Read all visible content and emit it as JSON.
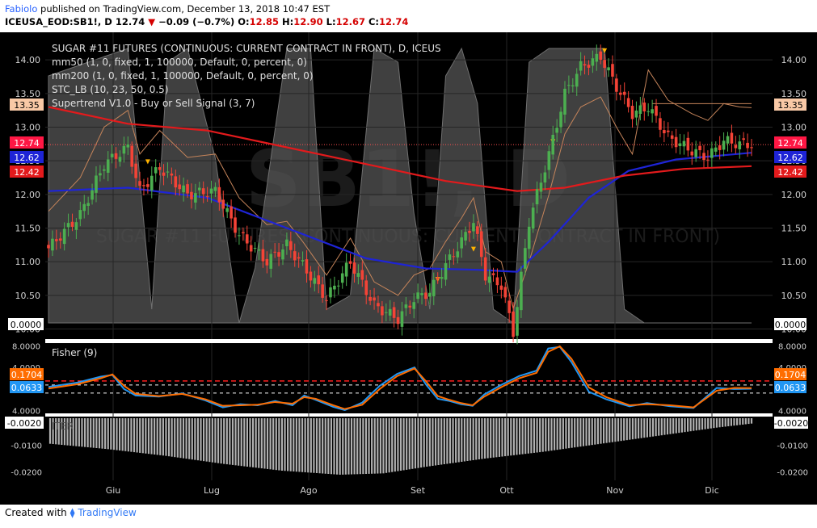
{
  "header": {
    "author": "Fabiolo",
    "published": "published on TradingView.com, December 13, 2018 10:47 EST",
    "symbol": "ICEUSA_EOD:SB1!, D",
    "last": "12.74",
    "change": "−0.09 (−0.7%)",
    "o_label": "O:",
    "o": "12.85",
    "h_label": "H:",
    "h": "12.90",
    "l_label": "L:",
    "l": "12.67",
    "c_label": "C:",
    "c": "12.74"
  },
  "watermark": "SB1!, D",
  "watermark_sub": "SUGAR #11 FUTURES (CONTINUOUS: CURRENT CONTRACT IN FRONT)",
  "legend": [
    "SUGAR #11 FUTURES (CONTINUOUS: CURRENT CONTRACT IN FRONT), D, ICEUS",
    "mm50 (1, 0, fixed, 1, 100000, Default, 0, percent, 0)",
    "mm200 (1, 0, fixed, 1, 100000, Default, 0, percent, 0)",
    "STC_LB (10, 23, 50, 0.5)",
    "Supertrend V1.0 - Buy or Sell Signal (3, 7)"
  ],
  "panes": {
    "fisher_label": "Fisher (9)",
    "iter_label": "ITER"
  },
  "price_badges": {
    "supertrend": "13.35",
    "last": "12.74",
    "mm50": "12.62",
    "mm200": "12.42",
    "stc": "0.0000",
    "fisher_signal": "0.1704",
    "fisher": "0.0633",
    "iter": "-0.0020"
  },
  "colors": {
    "up": "#4caf50",
    "down": "#f44336",
    "mm50": "#1e24d6",
    "mm200": "#e31a1c",
    "supertrend_line": "#c5845a",
    "supertrend_up": "#4caf50",
    "stc_fill": "#555555",
    "fisher": "#2196f3",
    "fisher_signal": "#ff6d00",
    "fisher_level": "#ff1f1f",
    "iter_bar": "#b0b0b0"
  },
  "chart_data": [
    {
      "type": "candlestick",
      "title": "SUGAR #11 FUTURES (CONTINUOUS: CURRENT CONTRACT IN FRONT), D, ICEUS",
      "x_ticks": [
        "Giu",
        "Lug",
        "Ago",
        "Set",
        "Ott",
        "Nov",
        "Dic"
      ],
      "y_ticks": [
        10.0,
        10.5,
        11.0,
        11.5,
        12.0,
        12.5,
        13.0,
        13.5,
        14.0
      ],
      "ylim": [
        9.85,
        14.35
      ],
      "n_bars": 140,
      "price_path_anchors": [
        [
          0,
          11.2
        ],
        [
          8,
          11.7
        ],
        [
          14,
          12.45
        ],
        [
          20,
          12.7
        ],
        [
          23,
          12.05
        ],
        [
          28,
          12.4
        ],
        [
          35,
          12.0
        ],
        [
          42,
          12.05
        ],
        [
          48,
          11.4
        ],
        [
          55,
          11.0
        ],
        [
          60,
          11.25
        ],
        [
          64,
          10.95
        ],
        [
          70,
          10.45
        ],
        [
          76,
          11.0
        ],
        [
          82,
          10.35
        ],
        [
          88,
          10.15
        ],
        [
          92,
          10.45
        ],
        [
          96,
          10.55
        ],
        [
          100,
          10.95
        ],
        [
          104,
          11.3
        ],
        [
          107,
          11.6
        ],
        [
          110,
          10.8
        ],
        [
          114,
          10.65
        ],
        [
          117,
          9.95
        ],
        [
          121,
          11.6
        ],
        [
          126,
          12.6
        ],
        [
          130,
          13.5
        ],
        [
          134,
          13.9
        ],
        [
          139,
          14.05
        ],
        [
          143,
          13.6
        ],
        [
          147,
          13.2
        ],
        [
          151,
          13.3
        ],
        [
          156,
          12.85
        ],
        [
          162,
          12.65
        ],
        [
          166,
          12.55
        ],
        [
          170,
          12.8
        ],
        [
          174,
          12.75
        ],
        [
          177,
          12.74
        ]
      ],
      "series": [
        {
          "name": "mm50",
          "points": [
            [
              0,
              12.05
            ],
            [
              20,
              12.1
            ],
            [
              40,
              11.95
            ],
            [
              60,
              11.5
            ],
            [
              80,
              11.05
            ],
            [
              95,
              10.9
            ],
            [
              108,
              10.88
            ],
            [
              118,
              10.85
            ],
            [
              126,
              11.3
            ],
            [
              136,
              11.95
            ],
            [
              146,
              12.35
            ],
            [
              158,
              12.52
            ],
            [
              177,
              12.62
            ]
          ]
        },
        {
          "name": "mm200",
          "points": [
            [
              0,
              13.3
            ],
            [
              20,
              13.05
            ],
            [
              40,
              12.95
            ],
            [
              60,
              12.7
            ],
            [
              80,
              12.45
            ],
            [
              100,
              12.2
            ],
            [
              118,
              12.05
            ],
            [
              130,
              12.1
            ],
            [
              145,
              12.28
            ],
            [
              160,
              12.38
            ],
            [
              177,
              12.42
            ]
          ]
        }
      ],
      "last_values": {
        "close": 12.74,
        "mm50": 12.62,
        "mm200": 12.42,
        "supertrend": 13.35
      }
    },
    {
      "type": "line",
      "title": "Fisher (9)",
      "y_ticks": [
        -4.0,
        4.0,
        8.0
      ],
      "ylim": [
        -4.5,
        8.5
      ],
      "levels": [
        1.5,
        0.75,
        -0.75
      ],
      "series": [
        {
          "name": "Fisher",
          "points": [
            [
              0,
              0.4
            ],
            [
              10,
              1.2
            ],
            [
              18,
              2.3
            ],
            [
              22,
              2.6
            ],
            [
              26,
              0.0
            ],
            [
              30,
              -1.2
            ],
            [
              38,
              -1.4
            ],
            [
              46,
              -0.8
            ],
            [
              54,
              -2.1
            ],
            [
              60,
              -3.4
            ],
            [
              66,
              -2.8
            ],
            [
              72,
              -3.0
            ],
            [
              78,
              -2.2
            ],
            [
              84,
              -3.0
            ],
            [
              88,
              -1.2
            ],
            [
              92,
              -2.0
            ],
            [
              98,
              -3.3
            ],
            [
              102,
              -3.9
            ],
            [
              108,
              -2.5
            ],
            [
              114,
              0.6
            ],
            [
              120,
              2.8
            ],
            [
              126,
              4.0
            ],
            [
              130,
              0.8
            ],
            [
              134,
              -1.8
            ],
            [
              138,
              -2.2
            ],
            [
              142,
              -2.8
            ],
            [
              146,
              -3.1
            ],
            [
              150,
              -1.0
            ],
            [
              156,
              0.8
            ],
            [
              162,
              2.4
            ],
            [
              168,
              3.4
            ],
            [
              172,
              7.5
            ],
            [
              176,
              7.8
            ],
            [
              180,
              5.0
            ],
            [
              186,
              -0.5
            ],
            [
              192,
              -1.9
            ],
            [
              200,
              -3.2
            ],
            [
              206,
              -2.6
            ],
            [
              214,
              -3.2
            ],
            [
              222,
              -3.5
            ],
            [
              230,
              0.2
            ],
            [
              236,
              0.0
            ],
            [
              242,
              0.06
            ]
          ]
        },
        {
          "name": "Signal",
          "points": [
            [
              0,
              0.1
            ],
            [
              10,
              0.9
            ],
            [
              18,
              2.0
            ],
            [
              22,
              2.7
            ],
            [
              26,
              0.6
            ],
            [
              30,
              -0.9
            ],
            [
              38,
              -1.3
            ],
            [
              46,
              -0.9
            ],
            [
              54,
              -1.9
            ],
            [
              60,
              -3.1
            ],
            [
              66,
              -3.0
            ],
            [
              72,
              -2.9
            ],
            [
              78,
              -2.4
            ],
            [
              84,
              -2.7
            ],
            [
              88,
              -1.5
            ],
            [
              92,
              -1.8
            ],
            [
              98,
              -3.0
            ],
            [
              102,
              -3.7
            ],
            [
              108,
              -2.9
            ],
            [
              114,
              0.0
            ],
            [
              120,
              2.4
            ],
            [
              126,
              3.8
            ],
            [
              130,
              1.4
            ],
            [
              134,
              -1.3
            ],
            [
              138,
              -2.0
            ],
            [
              142,
              -2.6
            ],
            [
              146,
              -3.0
            ],
            [
              150,
              -1.4
            ],
            [
              156,
              0.4
            ],
            [
              162,
              2.0
            ],
            [
              168,
              3.0
            ],
            [
              172,
              6.9
            ],
            [
              176,
              7.9
            ],
            [
              180,
              5.6
            ],
            [
              186,
              0.3
            ],
            [
              192,
              -1.5
            ],
            [
              200,
              -3.0
            ],
            [
              206,
              -2.8
            ],
            [
              214,
              -3.0
            ],
            [
              222,
              -3.4
            ],
            [
              230,
              -0.3
            ],
            [
              236,
              0.2
            ],
            [
              242,
              0.17
            ]
          ]
        }
      ],
      "last_values": {
        "Fisher": 0.0633,
        "Signal": 0.1704
      }
    },
    {
      "type": "bar",
      "title": "ITER",
      "y_ticks": [
        -0.002,
        -0.01,
        -0.02
      ],
      "ylim": [
        -0.0225,
        0.0
      ],
      "values_profile": [
        [
          0,
          -0.0095
        ],
        [
          20,
          -0.0115
        ],
        [
          40,
          -0.014
        ],
        [
          60,
          -0.017
        ],
        [
          80,
          -0.0195
        ],
        [
          100,
          -0.021
        ],
        [
          115,
          -0.0205
        ],
        [
          130,
          -0.018
        ],
        [
          150,
          -0.015
        ],
        [
          170,
          -0.0125
        ],
        [
          190,
          -0.0095
        ],
        [
          210,
          -0.0065
        ],
        [
          230,
          -0.0035
        ],
        [
          242,
          -0.002
        ]
      ],
      "last_value": -0.002
    }
  ]
}
